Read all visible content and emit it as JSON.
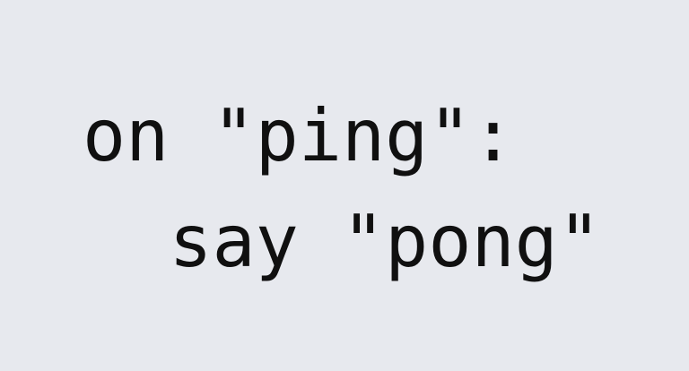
{
  "code": {
    "lines": [
      "on \"ping\":",
      "  say \"pong\""
    ]
  }
}
